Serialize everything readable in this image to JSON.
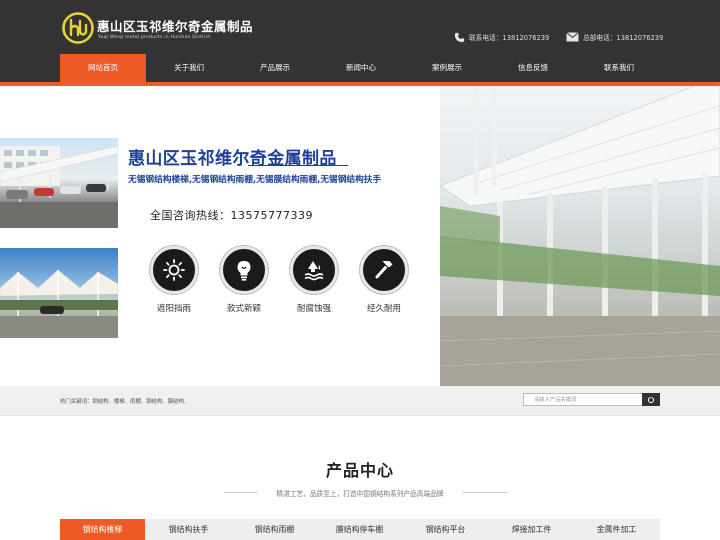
{
  "header": {
    "brand_title": "惠山区玉祁维尔奇金属制品",
    "brand_subtitle": "Yuqi Weiqi metal products in Huishan District",
    "contact_phone": "联系电话：13812076239",
    "hq_phone": "总部电话：13812076239",
    "colors": {
      "bar": "#333333",
      "accent": "#ef5b26",
      "logo": "#e8d23a"
    },
    "icons": [
      "logo-icon",
      "phone-icon",
      "mail-icon"
    ]
  },
  "nav": {
    "items": [
      {
        "label": "网站首页",
        "active": true
      },
      {
        "label": "关于我们",
        "active": false
      },
      {
        "label": "产品展示",
        "active": false
      },
      {
        "label": "新闻中心",
        "active": false
      },
      {
        "label": "案例展示",
        "active": false
      },
      {
        "label": "信息反馈",
        "active": false
      },
      {
        "label": "联系我们",
        "active": false
      }
    ]
  },
  "banner": {
    "title": "惠山区玉祁维尔奇金属制品",
    "subtitle": "无锡钢结构楼梯,无锡钢结构雨棚,无锡膜结构雨棚,无锡钢结构扶手",
    "hotline": "全国咨询热线：13575777339",
    "features": [
      {
        "icon": "sun-icon",
        "label": "遮阳挡雨"
      },
      {
        "icon": "lightbulb-icon",
        "label": "款式新颖"
      },
      {
        "icon": "corrosion-icon",
        "label": "耐腐蚀强"
      },
      {
        "icon": "hammer-icon",
        "label": "经久耐用"
      }
    ],
    "title_color": "#1f3f9a"
  },
  "search": {
    "hot_keywords": "热门关键词：钢结构、楼梯、雨棚、钢结构、膜结构、",
    "placeholder": "请输入产品关键词",
    "button_icon": "search-icon"
  },
  "products": {
    "title": "产品中心",
    "subtitle": "精湛工艺，品质至上，打造中国钢结构系列产品高端品牌",
    "tabs": [
      {
        "label": "钢结构楼梯",
        "active": true
      },
      {
        "label": "钢结构扶手",
        "active": false
      },
      {
        "label": "钢结构雨棚",
        "active": false
      },
      {
        "label": "膜结构停车棚",
        "active": false
      },
      {
        "label": "钢结构平台",
        "active": false
      },
      {
        "label": "焊接加工件",
        "active": false
      },
      {
        "label": "金属件加工",
        "active": false
      }
    ]
  }
}
